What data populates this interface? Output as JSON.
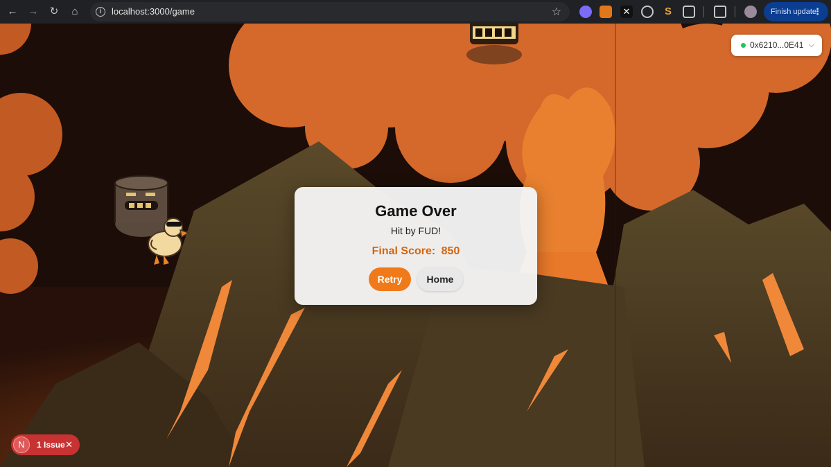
{
  "browser": {
    "url": "localhost:3000/game",
    "update_label": "Finish update"
  },
  "wallet": {
    "address": "0x6210...0E41",
    "status_color": "#22c55e"
  },
  "modal": {
    "title": "Game Over",
    "reason": "Hit by FUD!",
    "score_label": "Final Score:",
    "score_value": "850",
    "retry_label": "Retry",
    "home_label": "Home"
  },
  "dev_overlay": {
    "badge_letter": "N",
    "issue_label": "1 Issue"
  },
  "colors": {
    "accent": "#f07a1a",
    "score": "#d4650f",
    "lava": "#e8782a",
    "rock": "#4a3a22",
    "sky": "#1c0d08"
  }
}
